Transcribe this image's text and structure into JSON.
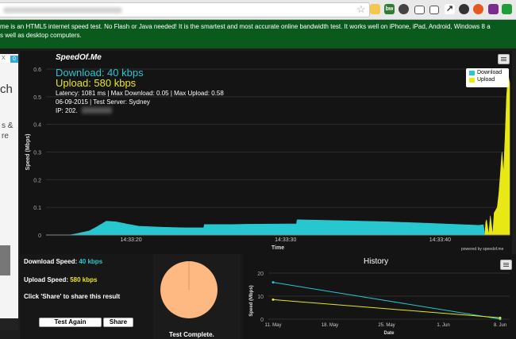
{
  "banner": {
    "line1": "me is an HTML5 internet speed test. No Flash or Java needed! It is the smartest and most accurate online bandwidth test. It works well on iPhone, iPad, Android, Windows 8 a",
    "line2": "s well as desktop computers."
  },
  "ad": {
    "badge": "0",
    "x": "X",
    "big": "ch",
    "small1": "s &",
    "small2": "re"
  },
  "toolbar": {
    "star": "☆"
  },
  "main_chart": {
    "brand": "SpeedOf.Me",
    "download_text": "Download: 40 kbps",
    "upload_text": "Upload: 580 kbps",
    "info1": "Latency: 1081 ms | Max Download: 0.05 | Max Upload: 0.58",
    "info2": "06-09-2015 | Test Server: Sydney",
    "info3": "IP: 202.",
    "powered": "powered by speedof.me",
    "legend": {
      "download": "Download",
      "upload": "Upload"
    }
  },
  "chart_data": [
    {
      "type": "area",
      "ylabel": "Speed (Mbps)",
      "xlabel": "Time",
      "ylim": [
        0,
        0.6
      ],
      "yticks": [
        0,
        0.1,
        0.2,
        0.3,
        0.4,
        0.5,
        0.6
      ],
      "xtick_labels": [
        "14:33:20",
        "14:33:30",
        "14:33:40"
      ],
      "xlim": [
        0,
        30
      ],
      "xticks": [
        5.5,
        15.5,
        25.5
      ],
      "series": [
        {
          "name": "Download",
          "color": "#26c7cf",
          "points": [
            [
              1.5,
              0
            ],
            [
              2.0,
              0.005
            ],
            [
              2.8,
              0.015
            ],
            [
              3.3,
              0.03
            ],
            [
              3.9,
              0.05
            ],
            [
              4.5,
              0.048
            ],
            [
              5.2,
              0.04
            ],
            [
              6.0,
              0.032
            ],
            [
              7.5,
              0.028
            ],
            [
              9.0,
              0.026
            ],
            [
              10.2,
              0.026
            ],
            [
              10.25,
              0.038
            ],
            [
              12.0,
              0.038
            ],
            [
              13.0,
              0.039
            ],
            [
              15.5,
              0.04
            ],
            [
              16.2,
              0.04
            ],
            [
              16.25,
              0.055
            ],
            [
              19.0,
              0.052
            ],
            [
              22.0,
              0.048
            ],
            [
              25.0,
              0.042
            ],
            [
              28.0,
              0.035
            ],
            [
              28.3,
              0.037
            ],
            [
              28.4,
              0.0
            ]
          ]
        },
        {
          "name": "Upload",
          "color": "#e8e814",
          "points": [
            [
              28.4,
              0
            ],
            [
              28.45,
              0.045
            ],
            [
              28.5,
              0.055
            ],
            [
              28.65,
              0.0
            ],
            [
              28.75,
              0.07
            ],
            [
              28.9,
              0.0
            ],
            [
              29.0,
              0.08
            ],
            [
              29.1,
              0.09
            ],
            [
              29.2,
              0.1
            ],
            [
              29.3,
              0.15
            ],
            [
              29.4,
              0.22
            ],
            [
              29.5,
              0.3
            ],
            [
              29.6,
              0.22
            ],
            [
              29.7,
              0.35
            ],
            [
              29.8,
              0.5
            ],
            [
              29.9,
              0.58
            ],
            [
              30.0,
              0.55
            ],
            [
              30.0,
              0
            ]
          ]
        }
      ]
    },
    {
      "type": "line",
      "title": "History",
      "ylabel": "Speed (Mbps)",
      "xlabel": "Date",
      "ylim": [
        0,
        20
      ],
      "yticks": [
        0,
        10,
        20
      ],
      "x_labels": [
        "11. May",
        "18. May",
        "25. May",
        "1. Jun",
        "8. Jun"
      ],
      "x_range": [
        0,
        4
      ],
      "series": [
        {
          "name": "Download",
          "color": "#26c7cf",
          "points": [
            [
              0,
              16
            ],
            [
              4,
              0.04
            ]
          ]
        },
        {
          "name": "Upload",
          "color": "#e8e814",
          "points": [
            [
              0,
              8.5
            ],
            [
              4,
              0.58
            ]
          ]
        }
      ]
    }
  ],
  "bottom": {
    "dl_label": "Download Speed: ",
    "dl_value": "40 kbps",
    "ul_label": "Upload Speed: ",
    "ul_value": "580 kbps",
    "share_hint": "Click 'Share' to share this result",
    "test_again": "Test Again",
    "share": "Share",
    "test_complete": "Test Complete.",
    "pie_color": "#fdb981"
  }
}
